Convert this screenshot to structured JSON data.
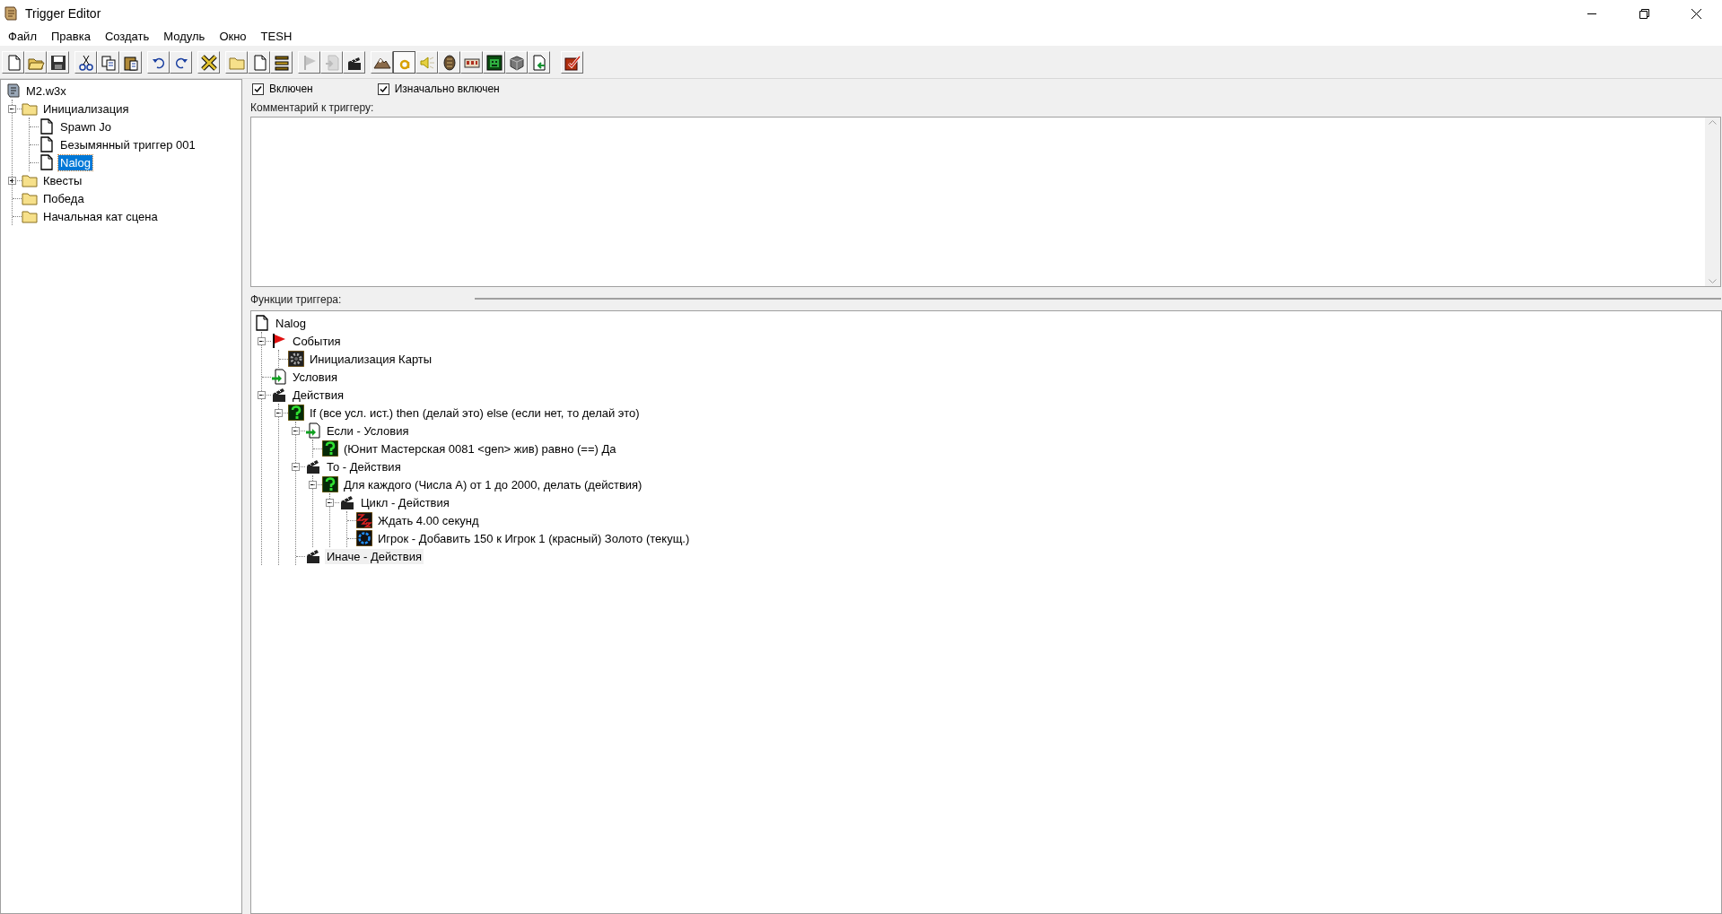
{
  "window": {
    "title": "Trigger Editor"
  },
  "menu": [
    "Файл",
    "Правка",
    "Создать",
    "Модуль",
    "Окно",
    "TESH"
  ],
  "toolbar": [
    [
      {
        "kind": "new",
        "disabled": false,
        "pressed": false
      },
      {
        "kind": "open",
        "disabled": false,
        "pressed": false
      },
      {
        "kind": "save",
        "disabled": false,
        "pressed": false
      }
    ],
    [
      {
        "kind": "cut",
        "disabled": false,
        "pressed": false
      },
      {
        "kind": "copy",
        "disabled": false,
        "pressed": false
      },
      {
        "kind": "paste",
        "disabled": false,
        "pressed": false
      }
    ],
    [
      {
        "kind": "undo",
        "disabled": false,
        "pressed": false
      },
      {
        "kind": "redo",
        "disabled": false,
        "pressed": false
      }
    ],
    [
      {
        "kind": "x",
        "disabled": false,
        "pressed": false
      }
    ],
    [
      {
        "kind": "folder",
        "disabled": false,
        "pressed": false
      },
      {
        "kind": "new",
        "disabled": false,
        "pressed": false
      },
      {
        "kind": "list",
        "disabled": false,
        "pressed": false
      }
    ],
    [
      {
        "kind": "flag",
        "disabled": true,
        "pressed": false
      },
      {
        "kind": "cond",
        "disabled": true,
        "pressed": false
      },
      {
        "kind": "clap",
        "disabled": false,
        "pressed": false
      }
    ],
    [
      {
        "kind": "terrain",
        "disabled": false,
        "pressed": false
      },
      {
        "kind": "a",
        "disabled": false,
        "pressed": true
      },
      {
        "kind": "sound",
        "disabled": false,
        "pressed": false
      },
      {
        "kind": "unit",
        "disabled": false,
        "pressed": false
      },
      {
        "kind": "panel",
        "disabled": false,
        "pressed": false
      },
      {
        "kind": "face",
        "disabled": false,
        "pressed": false
      },
      {
        "kind": "cube",
        "disabled": false,
        "pressed": false
      },
      {
        "kind": "import",
        "disabled": false,
        "pressed": false
      }
    ],
    [
      {
        "kind": "check",
        "disabled": false,
        "pressed": false
      }
    ]
  ],
  "trigger_tree": [
    {
      "label": "M2.w3x",
      "kind": "map",
      "selected": false,
      "children": [
        {
          "label": "Инициализация",
          "kind": "folder",
          "expanded": true,
          "selected": false,
          "children": [
            {
              "label": "Spawn Jo",
              "kind": "trigger",
              "selected": false
            },
            {
              "label": "Безымянный триггер 001",
              "kind": "trigger",
              "selected": false
            },
            {
              "label": "Nalog",
              "kind": "trigger",
              "selected": true
            }
          ]
        },
        {
          "label": "Квесты",
          "kind": "folder",
          "expanded": false,
          "selected": false
        },
        {
          "label": "Победа",
          "kind": "folder",
          "selected": false
        },
        {
          "label": "Начальная кат сцена",
          "kind": "folder",
          "selected": false
        }
      ]
    }
  ],
  "options": [
    {
      "label": "Включен",
      "checked": true
    },
    {
      "label": "Изначально включен",
      "checked": true
    }
  ],
  "comment": {
    "label": "Комментарий к триггеру:"
  },
  "functions": {
    "label": "Функции триггера:",
    "tree": [
      {
        "label": "Nalog",
        "kind": "trigger",
        "selected": false,
        "children": [
          {
            "label": "События",
            "kind": "event",
            "expanded": true,
            "selected": false,
            "children": [
              {
                "label": "Инициализация Карты",
                "kind": "gear",
                "selected": false
              }
            ]
          },
          {
            "label": "Условия",
            "kind": "condition",
            "selected": false
          },
          {
            "label": "Действия",
            "kind": "action",
            "expanded": true,
            "selected": false,
            "children": [
              {
                "label": "If (все усл. ист.) then (делай это) else (если нет, то делай это)",
                "kind": "logic",
                "expanded": true,
                "selected": false,
                "children": [
                  {
                    "label": "Если - Условия",
                    "kind": "condition",
                    "expanded": true,
                    "selected": false,
                    "children": [
                      {
                        "label": "(Юнит Мастерская 0081 <gen> жив) равно (==) Да",
                        "kind": "logic",
                        "selected": false
                      }
                    ]
                  },
                  {
                    "label": "То - Действия",
                    "kind": "action",
                    "expanded": true,
                    "selected": false,
                    "children": [
                      {
                        "label": "Для каждого (Числа A) от 1 до 2000, делать (действия)",
                        "kind": "logic",
                        "expanded": true,
                        "selected": false,
                        "children": [
                          {
                            "label": "Цикл - Действия",
                            "kind": "action",
                            "expanded": true,
                            "selected": false,
                            "children": [
                              {
                                "label": "Ждать 4.00 секунд",
                                "kind": "wait",
                                "selected": false
                              },
                              {
                                "label": "Игрок - Добавить 150 к Игрок 1 (красный) Золото (текущ.)",
                                "kind": "player",
                                "selected": false
                              }
                            ]
                          }
                        ]
                      }
                    ]
                  },
                  {
                    "label": "Иначе - Действия",
                    "kind": "action",
                    "selected": true
                  }
                ]
              }
            ]
          }
        ]
      }
    ]
  }
}
